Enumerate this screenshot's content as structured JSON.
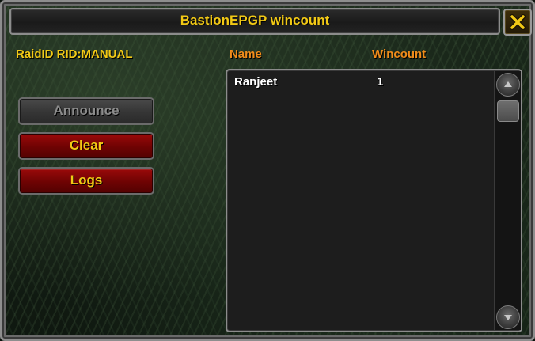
{
  "window": {
    "title": "BastionEPGP wincount",
    "close_icon": "close-x-icon"
  },
  "raid": {
    "label": "RaidID RID:MANUAL"
  },
  "buttons": {
    "announce": "Announce",
    "clear": "Clear",
    "logs": "Logs"
  },
  "table": {
    "headers": {
      "name": "Name",
      "wincount": "Wincount"
    },
    "rows": [
      {
        "name": "Ranjeet",
        "wincount": "1"
      }
    ]
  },
  "scrollbar": {
    "up_icon": "scroll-up-icon",
    "down_icon": "scroll-down-icon"
  },
  "colors": {
    "title_gold": "#f2c915",
    "header_orange": "#f08c1a",
    "button_red": "#7e0505",
    "button_disabled": "#3c3c3c"
  }
}
